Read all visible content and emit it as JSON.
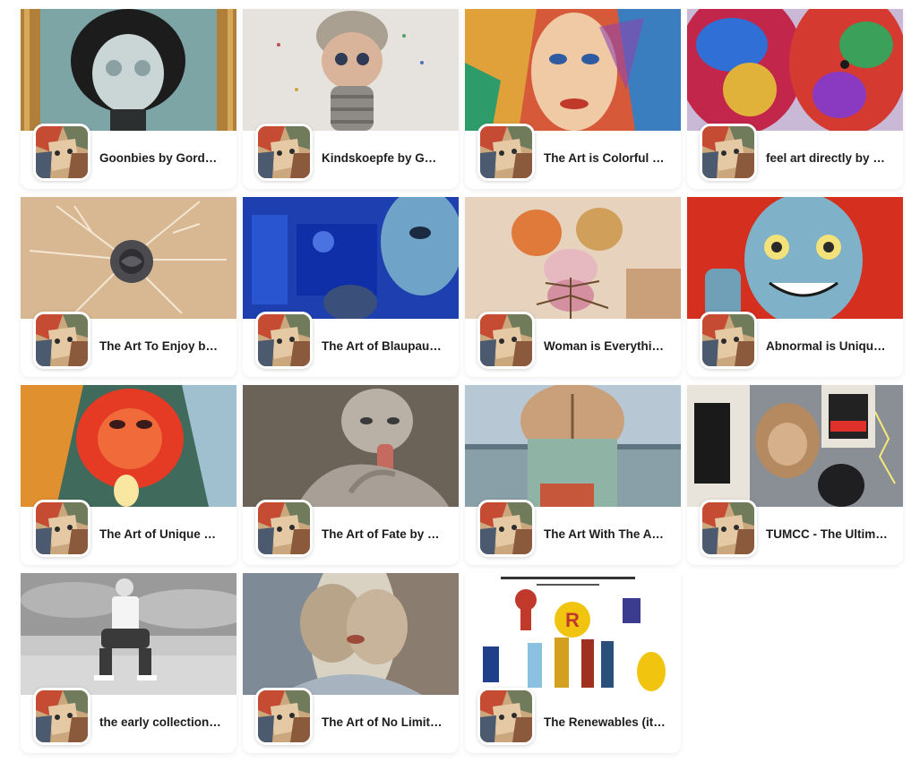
{
  "collections": [
    {
      "title": "Goonbies by Gordo...",
      "image": "portrait-doll-painting"
    },
    {
      "title": "Kindskoepfe by Gor...",
      "image": "big-head-child-figure"
    },
    {
      "title": "The Art is Colorful b...",
      "image": "colorful-face-painting"
    },
    {
      "title": "feel art directly by G...",
      "image": "colorful-abstract-heads"
    },
    {
      "title": "The Art To Enjoy by ...",
      "image": "black-rose-branches"
    },
    {
      "title": "The Art of Blaupaus...",
      "image": "blue-room-face"
    },
    {
      "title": "Woman is Everythin...",
      "image": "tree-woman-figure"
    },
    {
      "title": "Abnormal is Unique ...",
      "image": "blue-zombie-face"
    },
    {
      "title": "The Art of Unique NF...",
      "image": "red-glow-face"
    },
    {
      "title": "The Art of Fate by G...",
      "image": "grey-crying-figure"
    },
    {
      "title": "The Art With The As...",
      "image": "surreal-beach-figure"
    },
    {
      "title": "TUMCC - The Ultima...",
      "image": "ape-graffiti-collage"
    },
    {
      "title": "the early collection ...",
      "image": "bw-man-sitting-photo"
    },
    {
      "title": "The Art of No Limits ...",
      "image": "kissing-faces-abstract"
    },
    {
      "title": "The Renewables (it ...",
      "image": "comic-heroes-sheet"
    }
  ],
  "creator_avatar": "cubist-portrait-avatar"
}
